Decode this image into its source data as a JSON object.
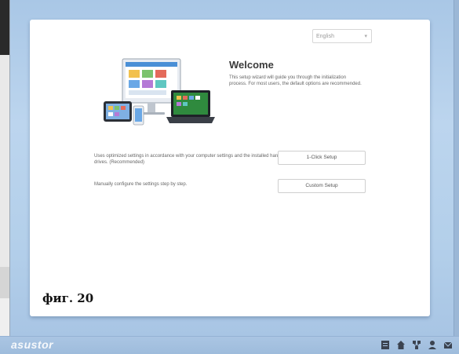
{
  "language_select": {
    "value": "English"
  },
  "welcome": {
    "title": "Welcome",
    "description": "This setup wizard will guide you through the initialization process. For most users, the default options are recommended."
  },
  "options": [
    {
      "description": "Uses optimized settings in accordance with your computer settings and the installed hard drives. (Recommended)",
      "button_label": "1-Click Setup"
    },
    {
      "description": "Manually configure the settings step by step.",
      "button_label": "Custom Setup"
    }
  ],
  "figure_label": "фиг. 20",
  "taskbar": {
    "brand": "asustor"
  },
  "icons": [
    "chevron-down-icon",
    "devices-illustration",
    "file-icon",
    "home-icon",
    "network-icon",
    "user-icon",
    "mail-icon"
  ]
}
